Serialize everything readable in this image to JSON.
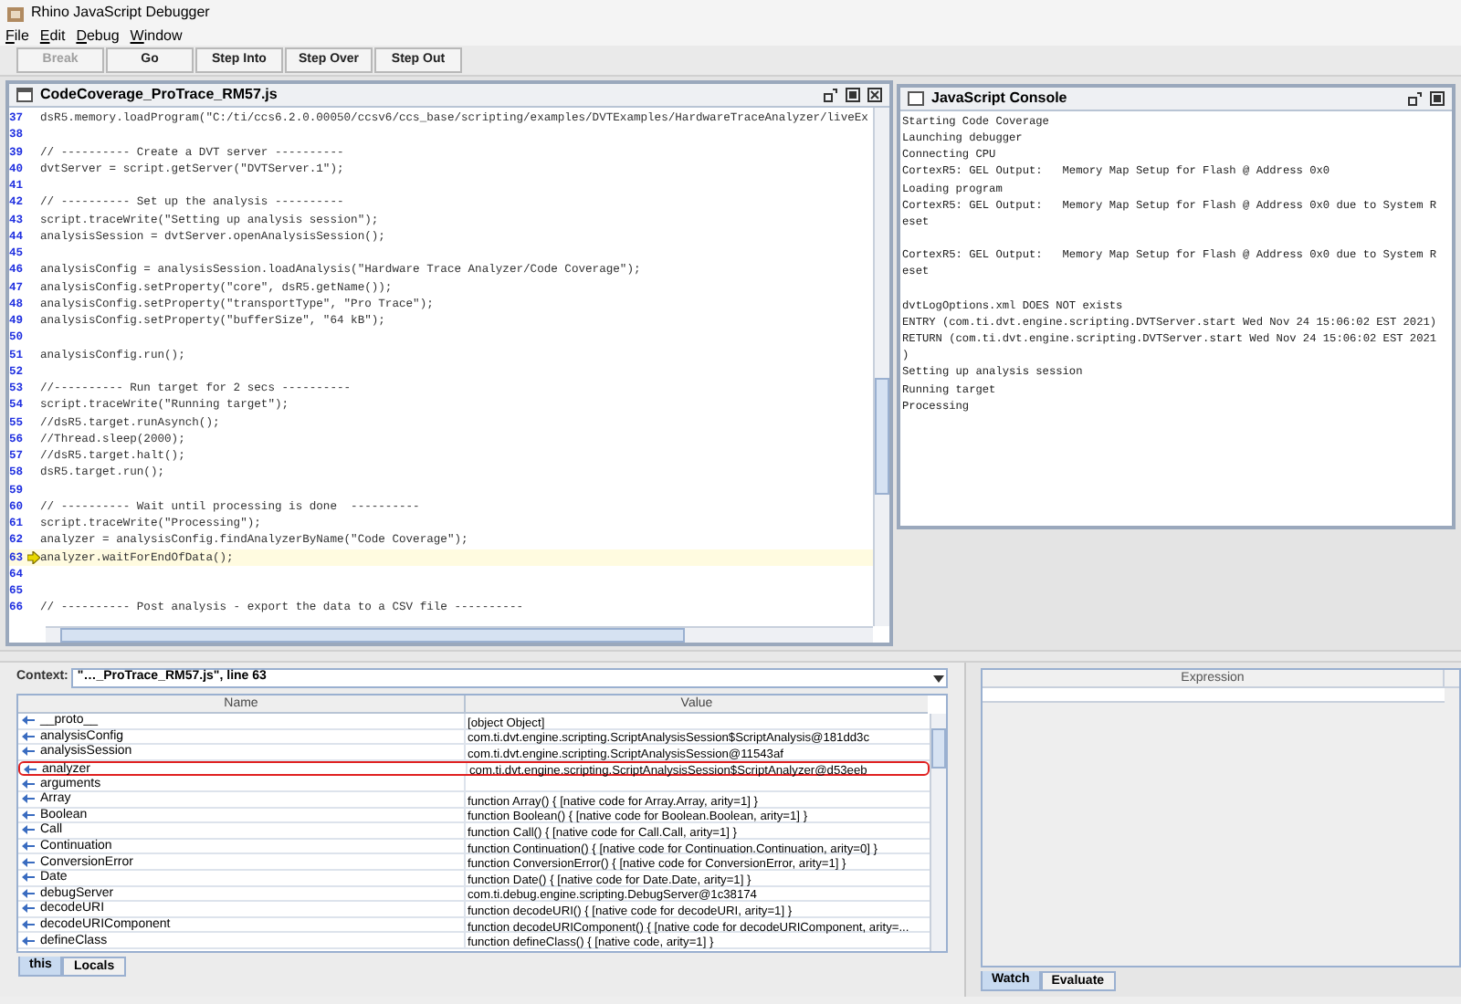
{
  "window": {
    "title": "Rhino JavaScript Debugger"
  },
  "menu": [
    {
      "label": "File"
    },
    {
      "label": "Edit"
    },
    {
      "label": "Debug"
    },
    {
      "label": "Window"
    }
  ],
  "toolbar": [
    {
      "label": "Break",
      "disabled": true
    },
    {
      "label": "Go",
      "disabled": false
    },
    {
      "label": "Step Into",
      "disabled": false
    },
    {
      "label": "Step Over",
      "disabled": false
    },
    {
      "label": "Step Out",
      "disabled": false
    }
  ],
  "editor": {
    "title": "CodeCoverage_ProTrace_RM57.js",
    "lines": [
      {
        "number": "37",
        "text": "dsR5.memory.loadProgram(\"C:/ti/ccs6.2.0.00050/ccsv6/ccs_base/scripting/examples/DVTExamples/HardwareTraceAnalyzer/liveEx",
        "current": false
      },
      {
        "number": "38",
        "current": false
      },
      {
        "number": "39",
        "text": "// ---------- Create a DVT server ----------",
        "current": false
      },
      {
        "number": "40",
        "text": "dvtServer = script.getServer(\"DVTServer.1\");",
        "current": false
      },
      {
        "number": "41",
        "current": false
      },
      {
        "number": "42",
        "text": "// ---------- Set up the analysis ----------",
        "current": false
      },
      {
        "number": "43",
        "text": "script.traceWrite(\"Setting up analysis session\");",
        "current": false
      },
      {
        "number": "44",
        "text": "analysisSession = dvtServer.openAnalysisSession();",
        "current": false
      },
      {
        "number": "45",
        "current": false
      },
      {
        "number": "46",
        "text": "analysisConfig = analysisSession.loadAnalysis(\"Hardware Trace Analyzer/Code Coverage\");",
        "current": false
      },
      {
        "number": "47",
        "text": "analysisConfig.setProperty(\"core\", dsR5.getName());",
        "current": false
      },
      {
        "number": "48",
        "text": "analysisConfig.setProperty(\"transportType\", \"Pro Trace\");",
        "current": false
      },
      {
        "number": "49",
        "text": "analysisConfig.setProperty(\"bufferSize\", \"64 kB\");",
        "current": false
      },
      {
        "number": "50",
        "current": false
      },
      {
        "number": "51",
        "text": "analysisConfig.run();",
        "current": false
      },
      {
        "number": "52",
        "current": false
      },
      {
        "number": "53",
        "text": "//---------- Run target for 2 secs ----------",
        "current": false
      },
      {
        "number": "54",
        "text": "script.traceWrite(\"Running target\");",
        "current": false
      },
      {
        "number": "55",
        "text": "//dsR5.target.runAsynch();",
        "current": false
      },
      {
        "number": "56",
        "text": "//Thread.sleep(2000);",
        "current": false
      },
      {
        "number": "57",
        "text": "//dsR5.target.halt();",
        "current": false
      },
      {
        "number": "58",
        "text": "dsR5.target.run();",
        "current": false
      },
      {
        "number": "59",
        "current": false
      },
      {
        "number": "60",
        "text": "// ---------- Wait until processing is done  ----------",
        "current": false
      },
      {
        "number": "61",
        "text": "script.traceWrite(\"Processing\");",
        "current": false
      },
      {
        "number": "62",
        "text": "analyzer = analysisConfig.findAnalyzerByName(\"Code Coverage\");",
        "current": false
      },
      {
        "number": "63",
        "text": "analyzer.waitForEndOfData();",
        "current": true
      },
      {
        "number": "64",
        "current": false
      },
      {
        "number": "65",
        "current": false
      },
      {
        "number": "66",
        "text": "// ---------- Post analysis - export the data to a CSV file ----------",
        "current": false
      }
    ]
  },
  "console": {
    "title": "JavaScript Console",
    "text": "Starting Code Coverage\nLaunching debugger\nConnecting CPU\nCortexR5: GEL Output:   Memory Map Setup for Flash @ Address 0x0\nLoading program\nCortexR5: GEL Output:   Memory Map Setup for Flash @ Address 0x0 due to System R\neset\n\nCortexR5: GEL Output:   Memory Map Setup for Flash @ Address 0x0 due to System R\neset\n\ndvtLogOptions.xml DOES NOT exists\nENTRY (com.ti.dvt.engine.scripting.DVTServer.start Wed Nov 24 15:06:02 EST 2021)\nRETURN (com.ti.dvt.engine.scripting.DVTServer.start Wed Nov 24 15:06:02 EST 2021\n)\nSetting up analysis session\nRunning target\nProcessing"
  },
  "context": {
    "label": "Context:",
    "value": "\"…_ProTrace_RM57.js\", line 63"
  },
  "variables": {
    "columns": [
      "Name",
      "Value"
    ],
    "rows": [
      {
        "name": "__proto__",
        "value": "[object Object]",
        "highlighted": false
      },
      {
        "name": "analysisConfig",
        "value": "com.ti.dvt.engine.scripting.ScriptAnalysisSession$ScriptAnalysis@181dd3c",
        "highlighted": false
      },
      {
        "name": "analysisSession",
        "value": "com.ti.dvt.engine.scripting.ScriptAnalysisSession@11543af",
        "highlighted": false
      },
      {
        "name": "analyzer",
        "value": "com.ti.dvt.engine.scripting.ScriptAnalysisSession$ScriptAnalyzer@d53eeb",
        "highlighted": true
      },
      {
        "name": "arguments",
        "highlighted": false
      },
      {
        "name": "Array",
        "value": "function Array() { [native code for Array.Array, arity=1] }",
        "highlighted": false
      },
      {
        "name": "Boolean",
        "value": "function Boolean() { [native code for Boolean.Boolean, arity=1] }",
        "highlighted": false
      },
      {
        "name": "Call",
        "value": "function Call() { [native code for Call.Call, arity=1] }",
        "highlighted": false
      },
      {
        "name": "Continuation",
        "value": "function Continuation() { [native code for Continuation.Continuation, arity=0] }",
        "highlighted": false
      },
      {
        "name": "ConversionError",
        "value": "function ConversionError() { [native code for ConversionError, arity=1] }",
        "highlighted": false
      },
      {
        "name": "Date",
        "value": "function Date() { [native code for Date.Date, arity=1] }",
        "highlighted": false
      },
      {
        "name": "debugServer",
        "value": "com.ti.debug.engine.scripting.DebugServer@1c38174",
        "highlighted": false
      },
      {
        "name": "decodeURI",
        "value": "function decodeURI() { [native code for decodeURI, arity=1] }",
        "highlighted": false
      },
      {
        "name": "decodeURIComponent",
        "value": "function decodeURIComponent() { [native code for decodeURIComponent, arity=...",
        "highlighted": false
      },
      {
        "name": "defineClass",
        "value": "function defineClass() {  [native code, arity=1] }",
        "highlighted": false
      }
    ]
  },
  "left_tabs": [
    {
      "label": "this",
      "selected": true
    },
    {
      "label": "Locals",
      "selected": false
    }
  ],
  "watch": {
    "columns": [
      "Expression"
    ]
  },
  "right_tabs": [
    {
      "label": "Watch",
      "selected": true
    },
    {
      "label": "Evaluate",
      "selected": false
    }
  ]
}
